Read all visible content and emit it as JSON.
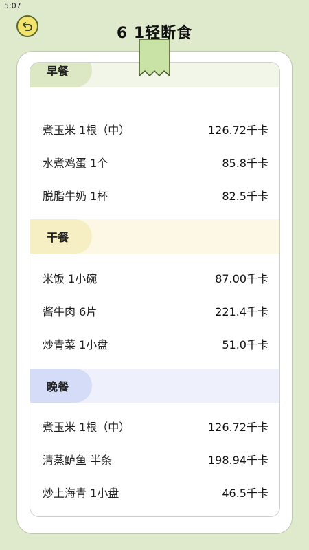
{
  "status": {
    "time": "5:07"
  },
  "header": {
    "title": "6 1轻断食"
  },
  "colors": {
    "background": "#dfe9cc",
    "breakfast_pill": "#dce8c4",
    "breakfast_band": "#f1f6e8",
    "lunch_pill": "#f7efc4",
    "lunch_band": "#fdf8e6",
    "dinner_pill": "#d5dcf7",
    "dinner_band": "#eef1fc",
    "ribbon": "#c9e3a6"
  },
  "sections": [
    {
      "name": "早餐",
      "items": [
        {
          "name": "煮玉米 1根（中）",
          "calories": "126.72千卡"
        },
        {
          "name": "水煮鸡蛋 1个",
          "calories": "85.8千卡"
        },
        {
          "name": "脱脂牛奶 1杯",
          "calories": "82.5千卡"
        }
      ]
    },
    {
      "name": "干餐",
      "items": [
        {
          "name": "米饭 1小碗",
          "calories": "87.00千卡"
        },
        {
          "name": "酱牛肉 6片",
          "calories": "221.4千卡"
        },
        {
          "name": "炒青菜 1小盘",
          "calories": "51.0千卡"
        }
      ]
    },
    {
      "name": "晚餐",
      "items": [
        {
          "name": "煮玉米 1根（中）",
          "calories": "126.72千卡"
        },
        {
          "name": "清蒸鲈鱼 半条",
          "calories": "198.94千卡"
        },
        {
          "name": "炒上海青 1小盘",
          "calories": "46.5千卡"
        }
      ]
    }
  ]
}
